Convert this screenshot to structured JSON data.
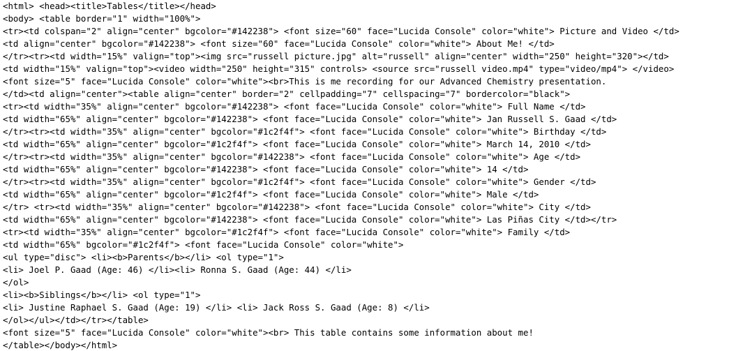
{
  "source_view": {
    "lines": [
      "<html> <head><title>Tables</title></head>",
      "<body> <table border=\"1\" width=\"100%\">",
      "<tr><td colspan=\"2\" align=\"center\" bgcolor=\"#142238\"> <font size=\"60\" face=\"Lucida Console\" color=\"white\"> Picture and Video </td>",
      "<td align=\"center\" bgcolor=\"#142238\"> <font size=\"60\" face=\"Lucida Console\" color=\"white\"> About Me! </td>",
      "</tr><tr><td width=\"15%\" valign=\"top\"><img src=\"russell picture.jpg\" alt=\"russell\" align=\"center\" width=\"250\" height=\"320\"></td>",
      "<td width=\"15%\" valign=\"top\"><video width=\"250\" height=\"315\" controls> <source src=\"russell video.mp4\" type=\"video/mp4\"> </video>",
      "<font size=\"5\" face=\"Lucida Console\" color=\"white\"><br>This is me recording for our Advanced Chemistry presentation.",
      "</td><td align=\"center\"><table align=\"center\" border=\"2\" cellpadding=\"7\" cellspacing=\"7\" bordercolor=\"black\">",
      "<tr><td width=\"35%\" align=\"center\" bgcolor=\"#142238\"> <font face=\"Lucida Console\" color=\"white\"> Full Name </td>",
      "<td width=\"65%\" align=\"center\" bgcolor=\"#142238\"> <font face=\"Lucida Console\" color=\"white\"> Jan Russell S. Gaad </td>",
      "</tr><tr><td width=\"35%\" align=\"center\" bgcolor=\"#1c2f4f\"> <font face=\"Lucida Console\" color=\"white\"> Birthday </td>",
      "<td width=\"65%\" align=\"center\" bgcolor=\"#1c2f4f\"> <font face=\"Lucida Console\" color=\"white\"> March 14, 2010 </td>",
      "</tr><tr><td width=\"35%\" align=\"center\" bgcolor=\"#142238\"> <font face=\"Lucida Console\" color=\"white\"> Age </td>",
      "<td width=\"65%\" align=\"center\" bgcolor=\"#142238\"> <font face=\"Lucida Console\" color=\"white\"> 14 </td>",
      "</tr><tr><td width=\"35%\" align=\"center\" bgcolor=\"#1c2f4f\"> <font face=\"Lucida Console\" color=\"white\"> Gender </td>",
      "<td width=\"65%\" align=\"center\" bgcolor=\"#1c2f4f\"> <font face=\"Lucida Console\" color=\"white\"> Male </td>",
      "</tr> <tr><td width=\"35%\" align=\"center\" bgcolor=\"#142238\"> <font face=\"Lucida Console\" color=\"white\"> City </td>",
      "<td width=\"65%\" align=\"center\" bgcolor=\"#142238\"> <font face=\"Lucida Console\" color=\"white\"> Las Piñas City </td></tr>",
      "<tr><td width=\"35%\" align=\"center\" bgcolor=\"#1c2f4f\"> <font face=\"Lucida Console\" color=\"white\"> Family </td>",
      "<td width=\"65%\" bgcolor=\"#1c2f4f\"> <font face=\"Lucida Console\" color=\"white\">",
      "<ul type=\"disc\"> <li><b>Parents</b></li> <ol type=\"1\">",
      "<li> Joel P. Gaad (Age: 46) </li><li> Ronna S. Gaad (Age: 44) </li>",
      "</ol>",
      "<li><b>Siblings</b></li> <ol type=\"1\">",
      "<li> Justine Raphael S. Gaad (Age: 19) </li> <li> Jack Ross S. Gaad (Age: 8) </li>",
      "</ol></ul></td></tr></table>",
      "<font size=\"5\" face=\"Lucida Console\" color=\"white\"><br> This table contains some information about me!",
      "</table></body></html>"
    ]
  }
}
